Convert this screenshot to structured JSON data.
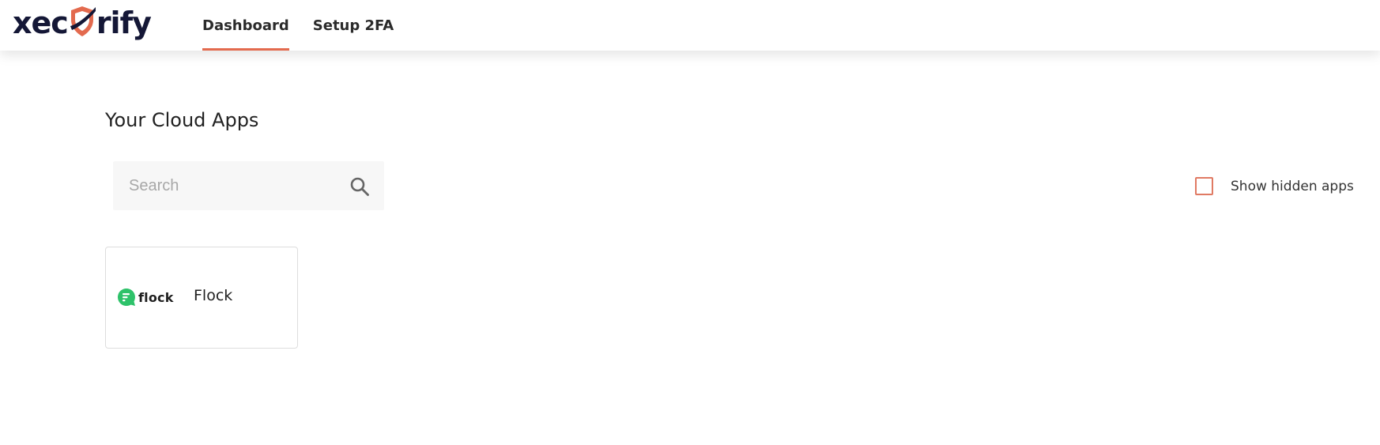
{
  "header": {
    "logo": {
      "prefix": "xec",
      "suffix": "rify",
      "brand_color": "#141736",
      "accent": "#e36a4e"
    },
    "tabs": [
      {
        "label": "Dashboard",
        "active": true
      },
      {
        "label": "Setup 2FA",
        "active": false
      }
    ]
  },
  "main": {
    "title": "Your Cloud Apps",
    "search": {
      "placeholder": "Search",
      "value": "",
      "icon": "search-icon"
    },
    "show_hidden": {
      "label": "Show hidden apps",
      "checked": false,
      "color": "#e07a63"
    },
    "apps": [
      {
        "name": "Flock",
        "logo_text": "flock",
        "logo_color": "#2ec26a",
        "icon": "flock-logo-icon"
      }
    ]
  }
}
